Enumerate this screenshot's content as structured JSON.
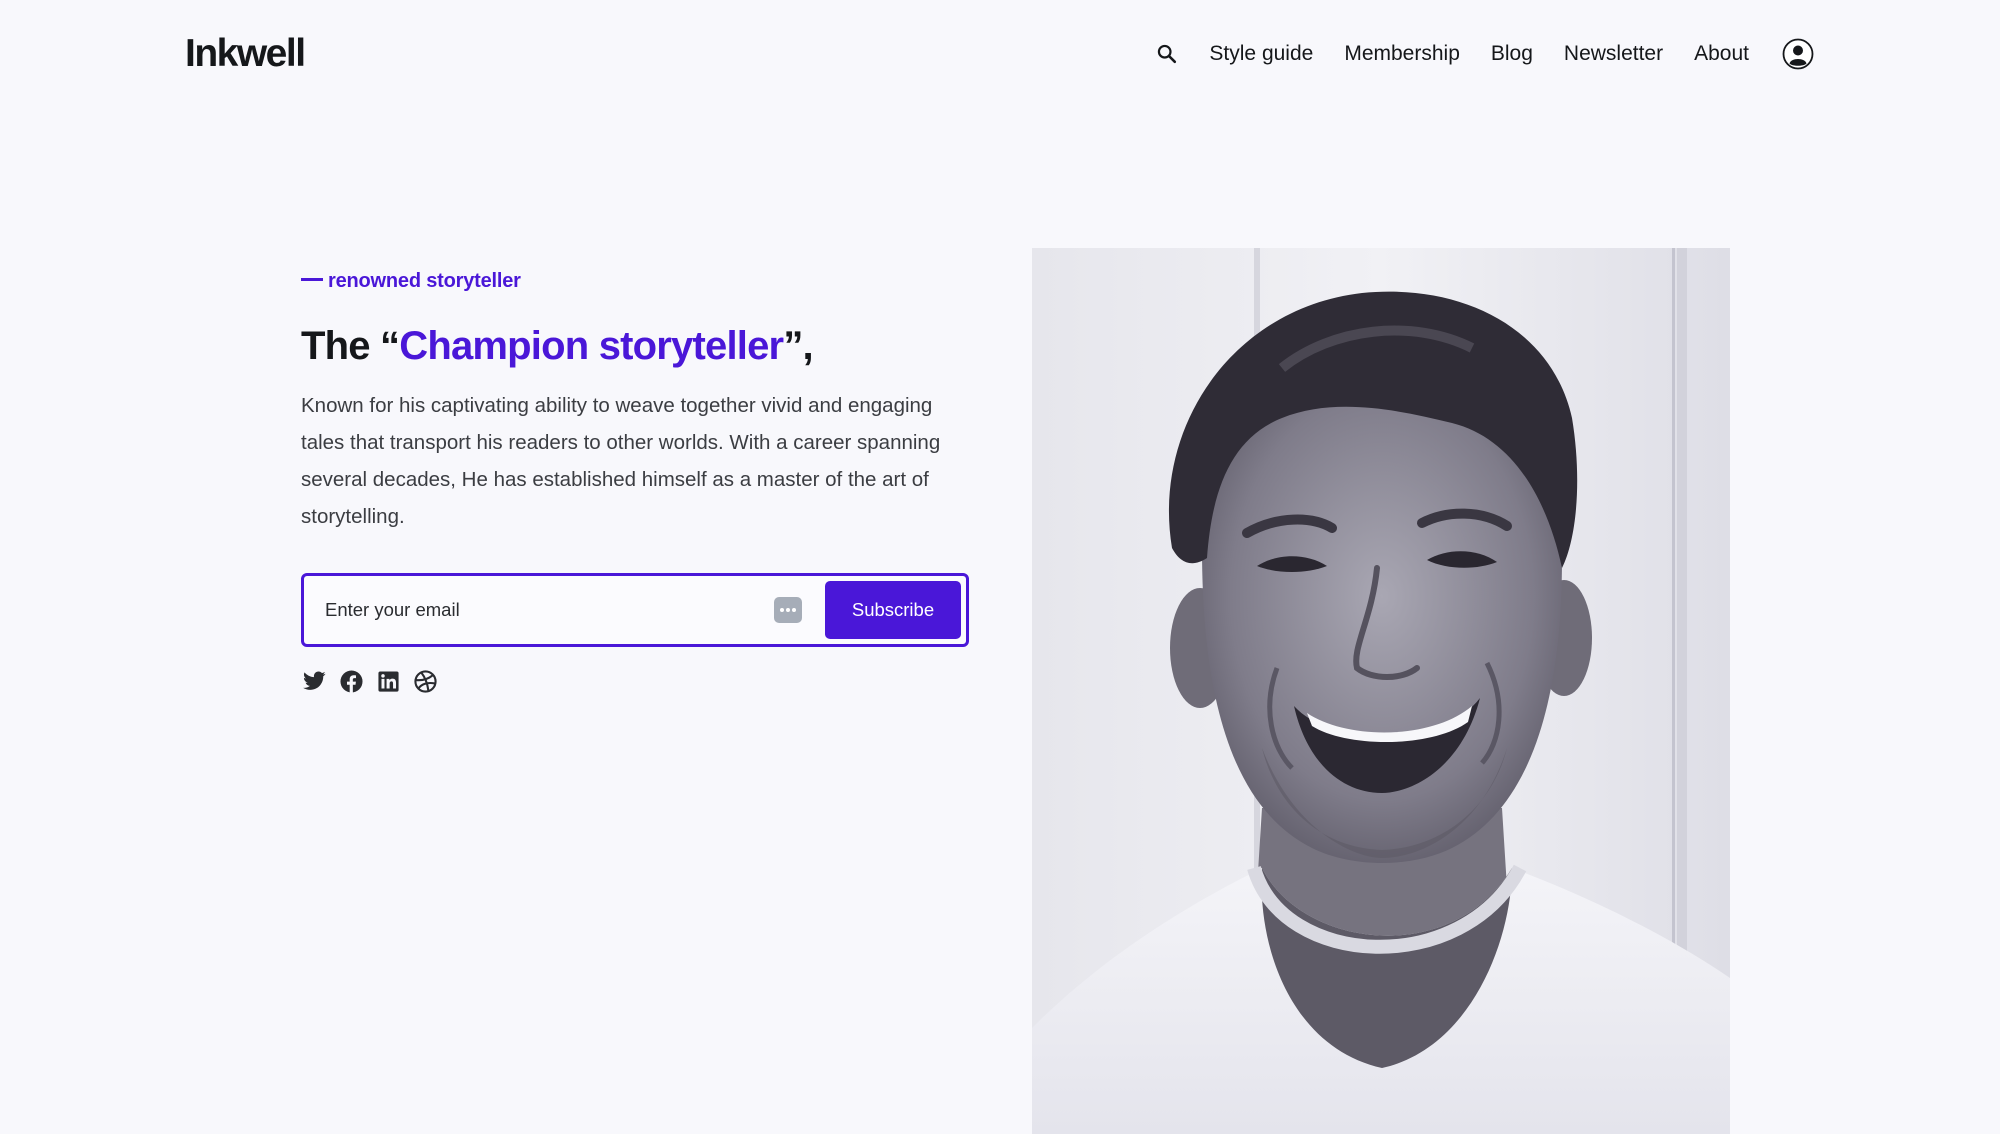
{
  "header": {
    "logo": "Inkwell",
    "nav": [
      {
        "label": "Style guide"
      },
      {
        "label": "Membership"
      },
      {
        "label": "Blog"
      },
      {
        "label": "Newsletter"
      },
      {
        "label": "About"
      }
    ],
    "icons": {
      "search": "search-icon",
      "account": "user-account-icon"
    }
  },
  "hero": {
    "eyebrow": "renowned storyteller",
    "headline_prefix": "The “",
    "headline_accent": "Champion storyteller",
    "headline_suffix": "”,",
    "description": "Known for his captivating ability to weave together vivid and engaging tales that transport his readers to other worlds. With a career spanning several decades, He has established himself as a master of the art of storytelling.",
    "subscribe": {
      "placeholder": "Enter your email",
      "value": "",
      "button_label": "Subscribe"
    },
    "socials": [
      {
        "icon": "twitter-icon"
      },
      {
        "icon": "facebook-icon"
      },
      {
        "icon": "linkedin-icon"
      },
      {
        "icon": "dribbble-icon"
      }
    ]
  },
  "colors": {
    "accent": "#4a17d8",
    "background": "#f8f8fc",
    "text": "#15171a"
  }
}
